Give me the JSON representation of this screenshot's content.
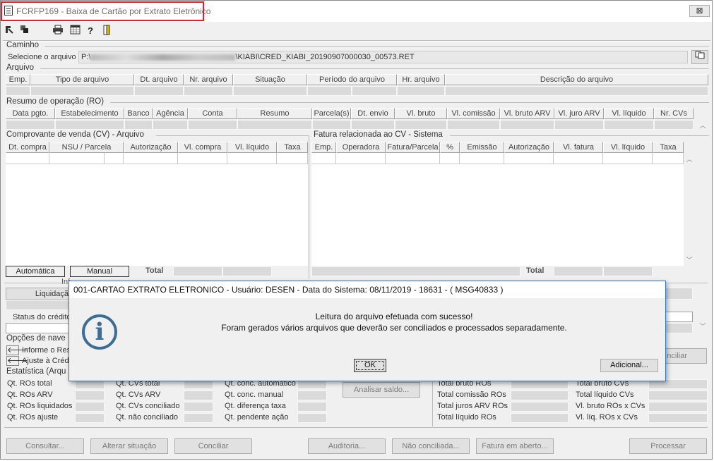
{
  "window": {
    "title": "FCRFP169 - Baixa de Cartão por Extrato Eletrônico",
    "close_glyph": "⊠"
  },
  "toolbar": {
    "icons": [
      "arrow-out-icon",
      "copy-layers-icon",
      "printer-icon",
      "calendar-icon",
      "help-icon",
      "exit-door-icon"
    ]
  },
  "caminho": {
    "section_label": "Caminho",
    "select_label": "Selecione o arquivo",
    "path_prefix": "P:\\",
    "path_suffix": "\\KIABI\\CRED_KIABI_20190907000030_00573.RET"
  },
  "arquivo": {
    "section_label": "Arquivo",
    "columns": [
      "Emp.",
      "Tipo de arquivo",
      "Dt. arquivo",
      "Nr. arquivo",
      "Situação",
      "Período do arquivo",
      "Hr. arquivo",
      "Descrição do arquivo"
    ]
  },
  "resumo": {
    "section_label": "Resumo de operação (RO)",
    "columns": [
      "Data pgto.",
      "Estabelecimento",
      "Banco",
      "Agência",
      "Conta",
      "Resumo",
      "Parcela(s)",
      "Dt. envio",
      "Vl. bruto",
      "Vl. comissão",
      "Vl. bruto ARV",
      "Vl. juro ARV",
      "Vl. líquido",
      "Nr. CVs"
    ]
  },
  "cv": {
    "section_label": "Comprovante de venda (CV) - Arquivo",
    "columns": [
      "Dt. compra",
      "NSU / Parcela",
      "Autorização",
      "Vl. compra",
      "Vl. líquido",
      "Taxa"
    ],
    "btn_auto": "Automática",
    "btn_manual": "Manual",
    "total_label": "Total"
  },
  "fatura": {
    "section_label": "Fatura relacionada ao CV - Sistema",
    "columns": [
      "Emp.",
      "Operadora",
      "Fatura/Parcela",
      "%",
      "Emissão",
      "Autorização",
      "Vl. fatura",
      "Vl. líquido",
      "Taxa"
    ],
    "total_label": "Total"
  },
  "info": {
    "partial_heading": "Inf",
    "liquidacao_label": "Liquidaçã",
    "status_label": "Status do crédito"
  },
  "opcoes": {
    "section_label": "Opções de nave",
    "informe_label": "Informe o Res",
    "ajuste_label": "Ajuste à Créd",
    "conciliar_partial": "nciliar"
  },
  "estatistica": {
    "section_label": "Estatística (Arqu",
    "col1": [
      "Qt. ROs total",
      "Qt. ROs ARV",
      "Qt. ROs liquidados",
      "Qt. ROs ajuste"
    ],
    "col2": [
      "Qt. CVs total",
      "Qt. CVs ARV",
      "Qt. CVs conciliado",
      "Qt. não conciliado"
    ],
    "col3": [
      "Qt. conc. automático",
      "Qt. conc. manual",
      "Qt. diferença taxa",
      "Qt. pendente ação"
    ],
    "analisar_button": "Analisar saldo...",
    "col4": [
      "Total bruto ROs",
      "Total comissão ROs",
      "Total juros ARV ROs",
      "Total líquido ROs"
    ],
    "col5": [
      "Total bruto CVs",
      "Total líquido CVs",
      "Vl. bruto ROs x CVs",
      "Vl. líq. ROs x CVs"
    ]
  },
  "bottom_buttons": [
    "Consultar...",
    "Alterar situação",
    "Conciliar",
    "Auditoria...",
    "Não conciliada...",
    "Fatura em aberto...",
    "Processar"
  ],
  "dialog": {
    "title": "001-CARTAO EXTRATO ELETRONICO - Usuário: DESEN - Data do Sistema: 08/11/2019 - 18631 - ( MSG40833 )",
    "line1": "Leitura do arquivo efetuada com sucesso!",
    "line2": "Foram gerados vários arquivos que deverão ser conciliados e processados separadamente.",
    "ok_label": "OK",
    "additional_label": "Adicional..."
  },
  "colors": {
    "dialog_border": "#2c78c4",
    "highlight_border": "#e0202a",
    "info_icon": "#3c6e95"
  }
}
